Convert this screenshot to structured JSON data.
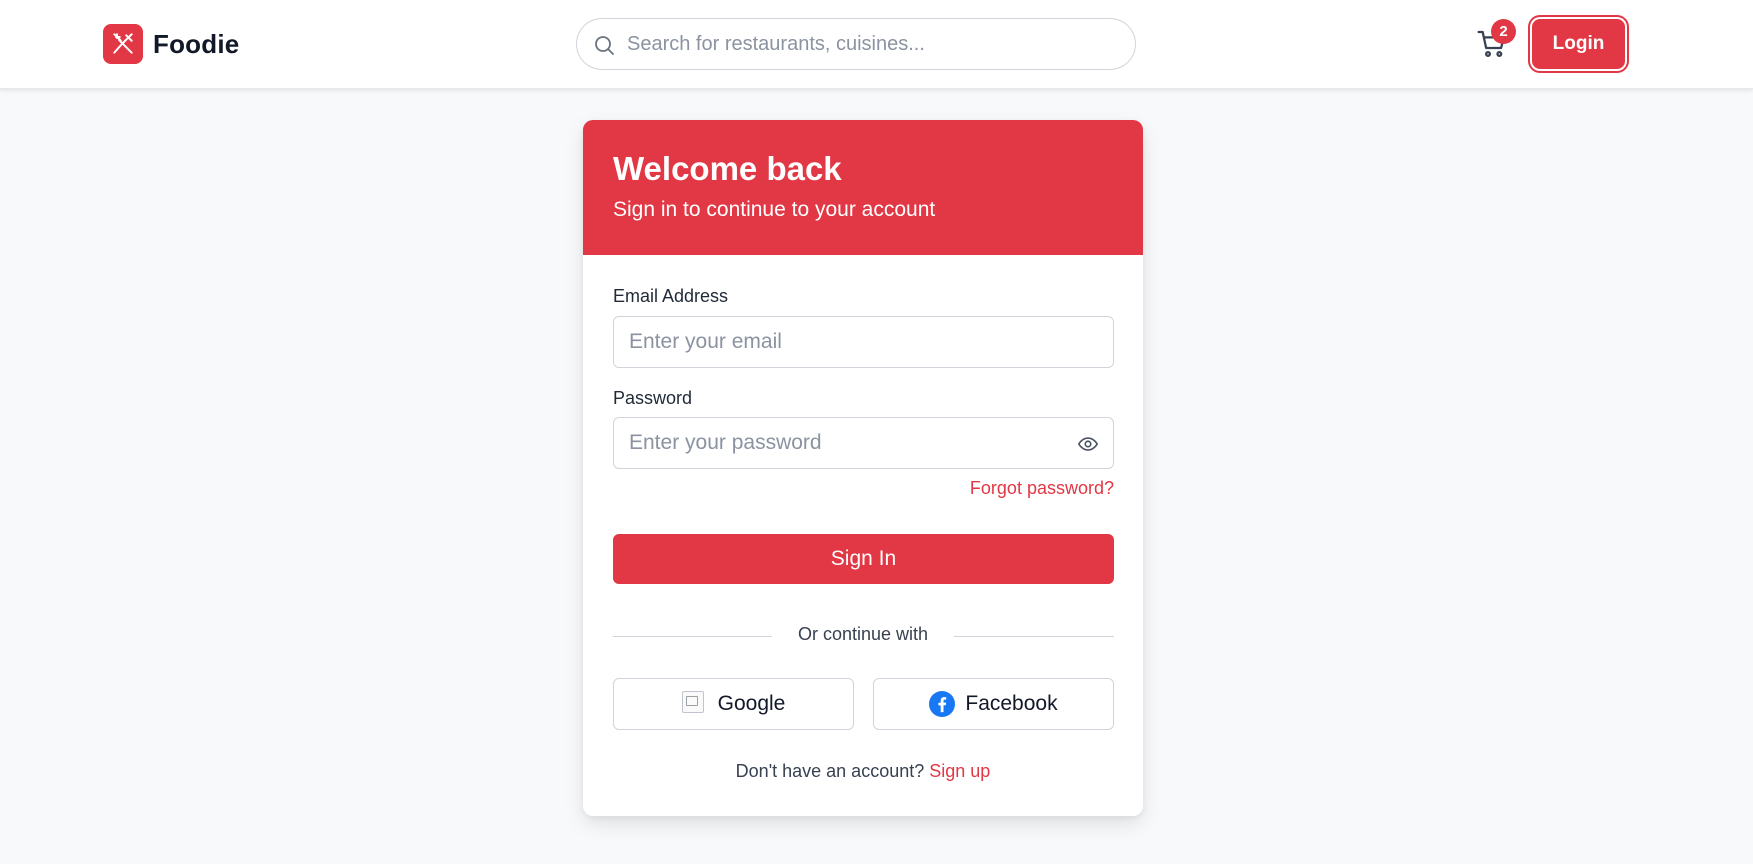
{
  "header": {
    "brand_name": "Foodie",
    "search_placeholder": "Search for restaurants, cuisines...",
    "cart_count": "2",
    "login_label": "Login"
  },
  "login_card": {
    "title": "Welcome back",
    "subtitle": "Sign in to continue to your account",
    "email_label": "Email Address",
    "email_placeholder": "Enter your email",
    "email_value": "",
    "password_label": "Password",
    "password_placeholder": "Enter your password",
    "password_value": "",
    "forgot_label": "Forgot password?",
    "signin_label": "Sign In",
    "divider_text": "Or continue with",
    "google_label": "Google",
    "facebook_label": "Facebook",
    "signup_prompt": "Don't have an account?",
    "signup_link": "Sign up"
  },
  "icons": {
    "brand_logo": "utensils-icon",
    "search": "search-icon",
    "cart": "shopping-cart-icon",
    "password_toggle": "eye-icon",
    "google": "google-icon",
    "facebook": "facebook-icon"
  },
  "colors": {
    "accent": "#e23744",
    "background": "#f8f9fb",
    "facebook_blue": "#1877f2"
  }
}
